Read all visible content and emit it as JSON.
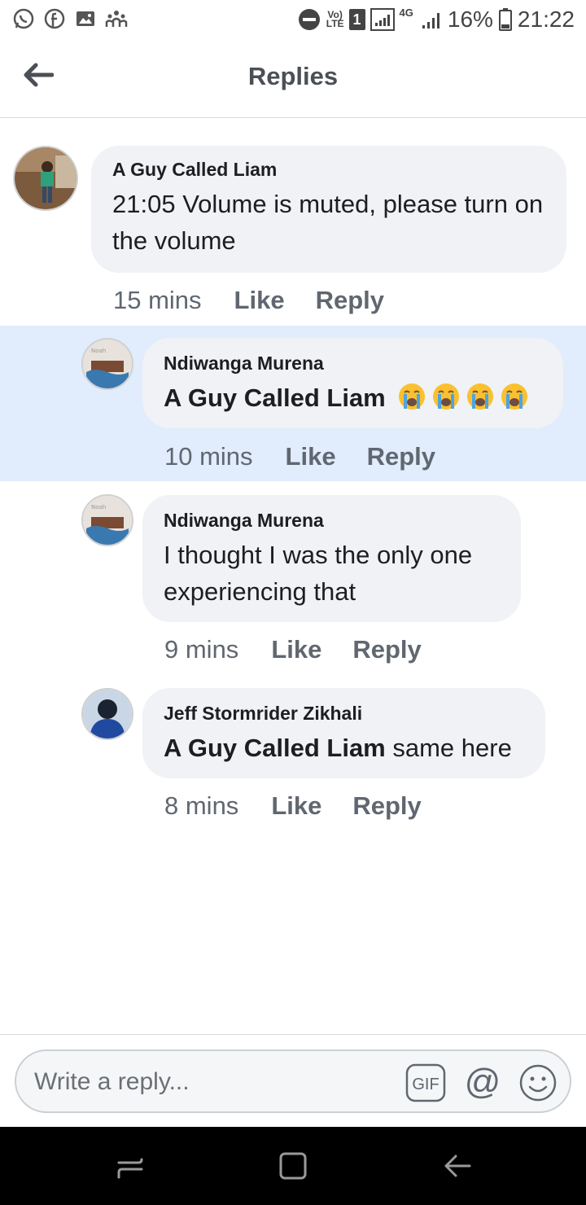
{
  "status_bar": {
    "left_icons": [
      "whatsapp-icon",
      "facebook-icon",
      "gallery-icon",
      "people-icon"
    ],
    "volte_line1": "Vo)",
    "volte_line2": "LTE",
    "sim": "1",
    "network": "4G",
    "battery": "16%",
    "time": "21:22"
  },
  "header": {
    "title": "Replies",
    "back_icon": "back-arrow-icon"
  },
  "comments": [
    {
      "author": "A Guy Called Liam",
      "text": "21:05 Volume is muted, please turn on the volume",
      "time": "15 mins",
      "like": "Like",
      "reply": "Reply"
    },
    {
      "author": "Ndiwanga Murena",
      "mention": "A Guy Called Liam",
      "text": "",
      "emojis": [
        "crying-face-emoji",
        "crying-face-emoji",
        "crying-face-emoji",
        "crying-face-emoji"
      ],
      "time": "10 mins",
      "like": "Like",
      "reply": "Reply",
      "highlighted": true
    },
    {
      "author": "Ndiwanga Murena",
      "text": "I thought I was the only one experiencing that",
      "time": "9 mins",
      "like": "Like",
      "reply": "Reply"
    },
    {
      "author": "Jeff Stormrider Zikhali",
      "mention": "A Guy Called Liam",
      "text": " same here",
      "time": "8 mins",
      "like": "Like",
      "reply": "Reply"
    }
  ],
  "composer": {
    "placeholder": "Write a reply...",
    "gif": "GIF",
    "at": "@"
  },
  "colors": {
    "highlight": "#e1ecfc",
    "bubble": "#f0f2f5",
    "meta": "#606770"
  }
}
